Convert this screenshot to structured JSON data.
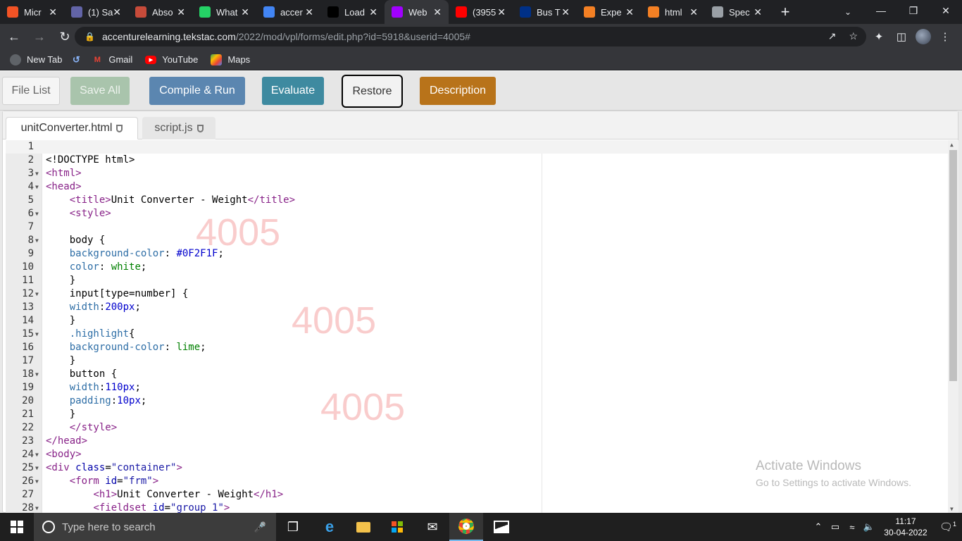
{
  "browser": {
    "tabs": [
      {
        "title": "Micr",
        "favicon": "microsoft-icon",
        "color": "#f35325"
      },
      {
        "title": "(1) Sa",
        "favicon": "teams-icon",
        "color": "#6264a7"
      },
      {
        "title": "Abso",
        "favicon": "briefcase-icon",
        "color": "#c74b3a"
      },
      {
        "title": "What",
        "favicon": "whatsapp-icon",
        "color": "#25d366"
      },
      {
        "title": "accer",
        "favicon": "google-icon",
        "color": "#4285f4"
      },
      {
        "title": "Load",
        "favicon": "loading-icon",
        "color": "#000000"
      },
      {
        "title": "Web",
        "favicon": "accenture-icon",
        "color": "#a100ff",
        "active": true
      },
      {
        "title": "(3955",
        "favicon": "youtube-icon",
        "color": "#ff0000"
      },
      {
        "title": "Bus T",
        "favicon": "paypal-icon",
        "color": "#003087"
      },
      {
        "title": "Expe",
        "favicon": "c-icon",
        "color": "#f48024"
      },
      {
        "title": "html",
        "favicon": "stackoverflow-icon",
        "color": "#f48024"
      },
      {
        "title": "Spec",
        "favicon": "globe-icon",
        "color": "#9aa0a6"
      }
    ],
    "url_host": "accenturelearning.tekstac.com",
    "url_path": "/2022/mod/vpl/forms/edit.php?id=5918&userid=4005#",
    "bookmarks": [
      "New Tab",
      "Gmail",
      "YouTube",
      "Maps"
    ]
  },
  "menu": {
    "file_list": "File List",
    "save_all": "Save All",
    "compile_run": "Compile & Run",
    "evaluate": "Evaluate",
    "restore": "Restore",
    "description": "Description"
  },
  "file_tabs": [
    "unitConverter.html",
    "script.js"
  ],
  "code_lines": [
    [],
    [
      [
        "t-txt",
        "<!DOCTYPE html>"
      ]
    ],
    [
      [
        "t-tag",
        "<html>"
      ]
    ],
    [
      [
        "t-tag",
        "<head>"
      ]
    ],
    [
      [
        "t-txt",
        "    "
      ],
      [
        "t-tag",
        "<title>"
      ],
      [
        "t-txt",
        "Unit Converter - Weight"
      ],
      [
        "t-tag",
        "</title>"
      ]
    ],
    [
      [
        "t-txt",
        "    "
      ],
      [
        "t-tag",
        "<style>"
      ]
    ],
    [],
    [
      [
        "t-txt",
        "    body {"
      ]
    ],
    [
      [
        "t-txt",
        "    "
      ],
      [
        "t-prop",
        "background-color"
      ],
      [
        "t-txt",
        ": "
      ],
      [
        "t-num",
        "#0F2F1F"
      ],
      [
        "t-txt",
        ";"
      ]
    ],
    [
      [
        "t-txt",
        "    "
      ],
      [
        "t-prop",
        "color"
      ],
      [
        "t-txt",
        ": "
      ],
      [
        "t-kw",
        "white"
      ],
      [
        "t-txt",
        ";"
      ]
    ],
    [
      [
        "t-txt",
        "    }"
      ]
    ],
    [
      [
        "t-txt",
        "    input[type=number] {"
      ]
    ],
    [
      [
        "t-txt",
        "    "
      ],
      [
        "t-prop",
        "width"
      ],
      [
        "t-txt",
        ":"
      ],
      [
        "t-num",
        "200px"
      ],
      [
        "t-txt",
        ";"
      ]
    ],
    [
      [
        "t-txt",
        "    }"
      ]
    ],
    [
      [
        "t-txt",
        "    "
      ],
      [
        "t-cls",
        ".highlight"
      ],
      [
        "t-txt",
        "{"
      ]
    ],
    [
      [
        "t-txt",
        "    "
      ],
      [
        "t-prop",
        "background-color"
      ],
      [
        "t-txt",
        ": "
      ],
      [
        "t-kw",
        "lime"
      ],
      [
        "t-txt",
        ";"
      ]
    ],
    [
      [
        "t-txt",
        "    }"
      ]
    ],
    [
      [
        "t-txt",
        "    button {"
      ]
    ],
    [
      [
        "t-txt",
        "    "
      ],
      [
        "t-prop",
        "width"
      ],
      [
        "t-txt",
        ":"
      ],
      [
        "t-num",
        "110px"
      ],
      [
        "t-txt",
        ";"
      ]
    ],
    [
      [
        "t-txt",
        "    "
      ],
      [
        "t-prop",
        "padding"
      ],
      [
        "t-txt",
        ":"
      ],
      [
        "t-num",
        "10px"
      ],
      [
        "t-txt",
        ";"
      ]
    ],
    [
      [
        "t-txt",
        "    }"
      ]
    ],
    [
      [
        "t-txt",
        "    "
      ],
      [
        "t-tag",
        "</style>"
      ]
    ],
    [
      [
        "t-tag",
        "</head>"
      ]
    ],
    [
      [
        "t-tag",
        "<body>"
      ]
    ],
    [
      [
        "t-tag",
        "<div "
      ],
      [
        "t-attr",
        "class"
      ],
      [
        "t-txt",
        "="
      ],
      [
        "t-str",
        "\"container\""
      ],
      [
        "t-tag",
        ">"
      ]
    ],
    [
      [
        "t-txt",
        "    "
      ],
      [
        "t-tag",
        "<form "
      ],
      [
        "t-attr",
        "id"
      ],
      [
        "t-txt",
        "="
      ],
      [
        "t-str",
        "\"frm\""
      ],
      [
        "t-tag",
        ">"
      ]
    ],
    [
      [
        "t-txt",
        "        "
      ],
      [
        "t-tag",
        "<h1>"
      ],
      [
        "t-txt",
        "Unit Converter - Weight"
      ],
      [
        "t-tag",
        "</h1>"
      ]
    ],
    [
      [
        "t-txt",
        "        "
      ],
      [
        "t-tag",
        "<fieldset "
      ],
      [
        "t-attr",
        "id"
      ],
      [
        "t-txt",
        "="
      ],
      [
        "t-str",
        "\"group 1\""
      ],
      [
        "t-tag",
        ">"
      ]
    ]
  ],
  "fold_lines": [
    3,
    4,
    6,
    8,
    12,
    15,
    18,
    24,
    25,
    26,
    28
  ],
  "watermark": "4005",
  "activate": {
    "title": "Activate Windows",
    "subtitle": "Go to Settings to activate Windows."
  },
  "taskbar": {
    "search_placeholder": "Type here to search",
    "time": "11:17",
    "date": "30-04-2022",
    "notifications": "1"
  }
}
